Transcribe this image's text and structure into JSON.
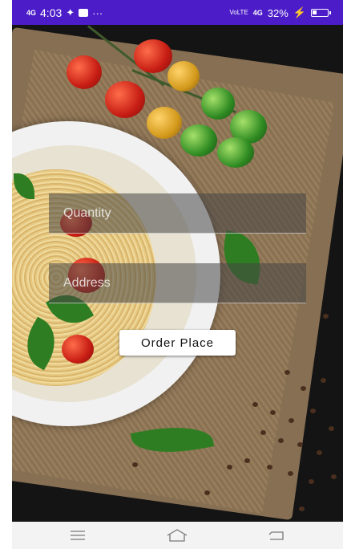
{
  "status_bar": {
    "network": "4G",
    "time": "4:03",
    "extra": "⚲ ···",
    "volte": "VoLTE",
    "network_right": "4G",
    "battery": "32%",
    "battery_level": 0.32
  },
  "form": {
    "quantity_placeholder": "Quantity",
    "address_placeholder": "Address",
    "order_button": "Order Place"
  },
  "navigation": {
    "menu_icon": "menu-icon",
    "home_icon": "home-icon",
    "back_icon": "back-icon"
  },
  "colors": {
    "status_bar": "#4b1cc8",
    "button_bg": "#ffffff",
    "nav_bar": "#f3f3f3"
  }
}
